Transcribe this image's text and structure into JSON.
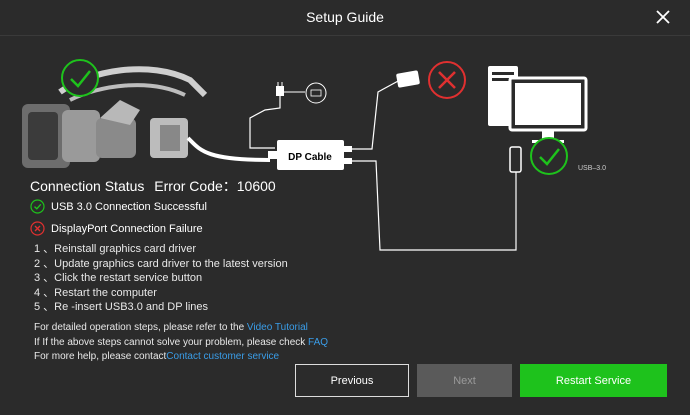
{
  "window": {
    "title": "Setup Guide"
  },
  "diagram": {
    "dp_cable_label": "DP Cable",
    "usb_label": "USB–3.0"
  },
  "status": {
    "title": "Connection Status",
    "error_label": "Error Code：10600",
    "usb_status": "USB 3.0 Connection Successful",
    "dp_status": "DisplayPort Connection Failure"
  },
  "steps": [
    "1 、Reinstall graphics card driver",
    "2 、Update graphics card driver to the latest version",
    "3 、Click the restart service button",
    "4 、Restart the computer",
    "5 、Re -insert USB3.0 and DP lines"
  ],
  "help": {
    "line1_prefix": "For detailed operation steps, please refer to the ",
    "line1_link": "Video Tutorial",
    "line2_prefix": "If If the above steps cannot solve your problem, please check ",
    "line2_link": "FAQ",
    "line3_prefix": "For more help, please contact",
    "line3_link": "Contact customer service"
  },
  "buttons": {
    "previous": "Previous",
    "next": "Next",
    "restart": "Restart Service"
  },
  "colors": {
    "success": "#1ec21c",
    "error": "#e03030",
    "link": "#3a9de8",
    "background": "#2b2b2b"
  }
}
